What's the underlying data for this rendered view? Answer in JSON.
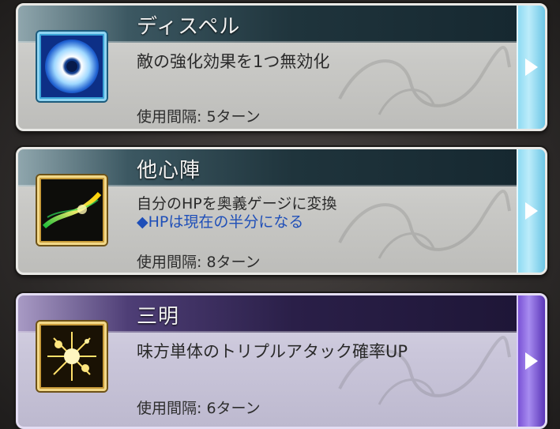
{
  "skills": [
    {
      "name": "ディスペル",
      "icon": "dispel-orb-icon",
      "frame": "blue",
      "description": "敵の強化効果を1つ無効化",
      "note": "",
      "cooldown_label": "使用間隔: 5ターン"
    },
    {
      "name": "他心陣",
      "icon": "green-yellow-streak-icon",
      "frame": "gold",
      "description": "自分のHPを奥義ゲージに変換",
      "note": "◆HPは現在の半分になる",
      "cooldown_label": "使用間隔: 8ターン"
    },
    {
      "name": "三明",
      "icon": "golden-sparkle-icon",
      "frame": "gold",
      "description": "味方単体のトリプルアタック確率UP",
      "note": "",
      "cooldown_label": "使用間隔: 6ターン"
    }
  ],
  "colors": {
    "silver_card": "#c9c9c6",
    "purple_card": "#cac6da",
    "note_text": "#1f4fb8",
    "blue_button": "#8fdbf3",
    "purple_button": "#7a52d6"
  }
}
